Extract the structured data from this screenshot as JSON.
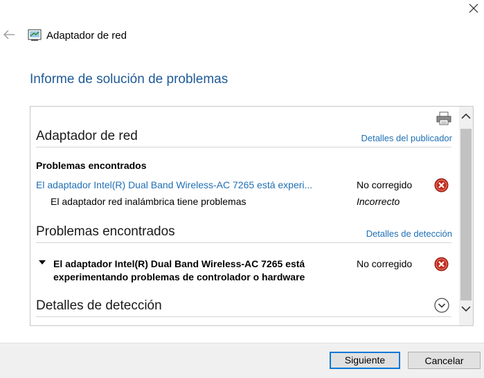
{
  "window": {
    "title": "Adaptador de red"
  },
  "page_title": "Informe de solución de problemas",
  "adapter_section": {
    "heading": "Adaptador de red",
    "link": "Detalles del publicador",
    "label": "Problemas encontrados",
    "rows": [
      {
        "text": "El adaptador Intel(R) Dual Band Wireless-AC 7265 está experi...",
        "status": "No corregido"
      },
      {
        "text": "El adaptador red inalámbrica tiene problemas",
        "status": "Incorrecto"
      }
    ]
  },
  "problems_section": {
    "heading": "Problemas encontrados",
    "link": "Detalles de detección",
    "item_text": "El adaptador Intel(R) Dual Band Wireless-AC 7265 está experimentando problemas de controlador o hardware",
    "item_status": "No corregido"
  },
  "detection_section": {
    "heading": "Detalles de detección"
  },
  "buttons": {
    "next": "Siguiente",
    "cancel": "Cancelar"
  },
  "icons": {
    "close": "close-icon",
    "back": "back-arrow-icon",
    "app": "network-adapter-icon",
    "print": "printer-icon",
    "error": "error-x-icon",
    "expand": "chevron-down-circle-icon"
  },
  "colors": {
    "title_blue": "#1f5a96",
    "link_blue": "#1f6fb5",
    "error_red": "#c42b1c",
    "primary_border": "#0078d7"
  }
}
